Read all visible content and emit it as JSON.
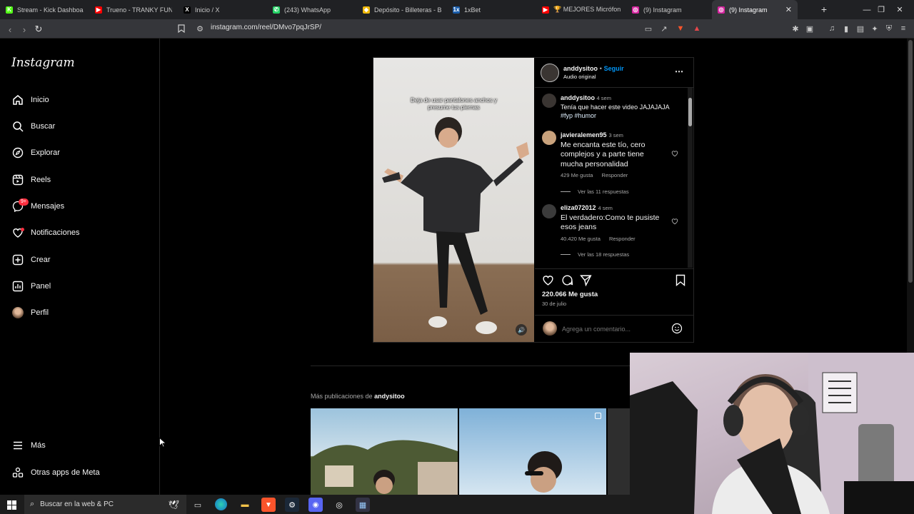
{
  "browser": {
    "tabs": [
      {
        "label": "Stream - Kick Dashboard",
        "fav": "K",
        "color": "#53fc18"
      },
      {
        "label": "Trueno - TRANKY FUNKY (",
        "fav": "▶",
        "color": "#ff0000"
      },
      {
        "label": "Inicio / X",
        "fav": "X",
        "color": "#000000"
      },
      {
        "label": "(243) WhatsApp",
        "fav": "✆",
        "color": "#25d366"
      },
      {
        "label": "Depósito - Billeteras - Bina",
        "fav": "◆",
        "color": "#f0b90b"
      },
      {
        "label": "1xBet",
        "fav": "1x",
        "color": "#1a5dab"
      },
      {
        "label": "🏆 MEJORES Micrófonos (",
        "fav": "▶",
        "color": "#ff0000"
      },
      {
        "label": "(9) Instagram",
        "fav": "◎",
        "color": "#d6249f"
      },
      {
        "label": "(9) Instagram",
        "fav": "◎",
        "color": "#d6249f",
        "active": true
      }
    ],
    "url": "instagram.com/reel/DMvo7pqJrSP/"
  },
  "sidebar": {
    "logo": "Instagram",
    "items": [
      {
        "label": "Inicio",
        "icon": "home-icon"
      },
      {
        "label": "Buscar",
        "icon": "search-icon"
      },
      {
        "label": "Explorar",
        "icon": "compass-icon"
      },
      {
        "label": "Reels",
        "icon": "reels-icon"
      },
      {
        "label": "Mensajes",
        "icon": "messenger-icon",
        "badge": "9+"
      },
      {
        "label": "Notificaciones",
        "icon": "heart-icon"
      },
      {
        "label": "Crear",
        "icon": "plus-square-icon"
      },
      {
        "label": "Panel",
        "icon": "chart-icon"
      },
      {
        "label": "Perfil",
        "icon": "avatar-icon"
      }
    ],
    "more": "Más",
    "meta": "Otras apps de Meta"
  },
  "post": {
    "overlay_text": "Deja de usar pantalones anchos y presume tus piernas",
    "author": "anddysitoo",
    "follow": "Seguir",
    "separator": "•",
    "audio": "Audio original",
    "caption": {
      "user": "anddysitoo",
      "time": "4 sem",
      "text": "Tenía que hacer este video JAJAJAJA",
      "tags": "#fyp #humor"
    },
    "comments": [
      {
        "user": "javieralemen95",
        "time": "3 sem",
        "text": "Me encanta este tío, cero complejos y a parte tiene mucha personalidad",
        "likes": "429 Me gusta",
        "reply": "Responder",
        "replies": "Ver las 11 respuestas"
      },
      {
        "user": "eliza072012",
        "time": "4 sem",
        "text": "El verdadero:Como te pusiste esos jeans",
        "likes": "40.420 Me gusta",
        "reply": "Responder",
        "replies": "Ver las 18 respuestas"
      }
    ],
    "likes": "220.066 Me gusta",
    "date": "30 de julio",
    "comment_placeholder": "Agrega un comentario..."
  },
  "more_posts": {
    "prefix": "Más publicaciones de",
    "user": "andysitoo"
  },
  "taskbar": {
    "search_placeholder": "Buscar en la web & PC"
  }
}
